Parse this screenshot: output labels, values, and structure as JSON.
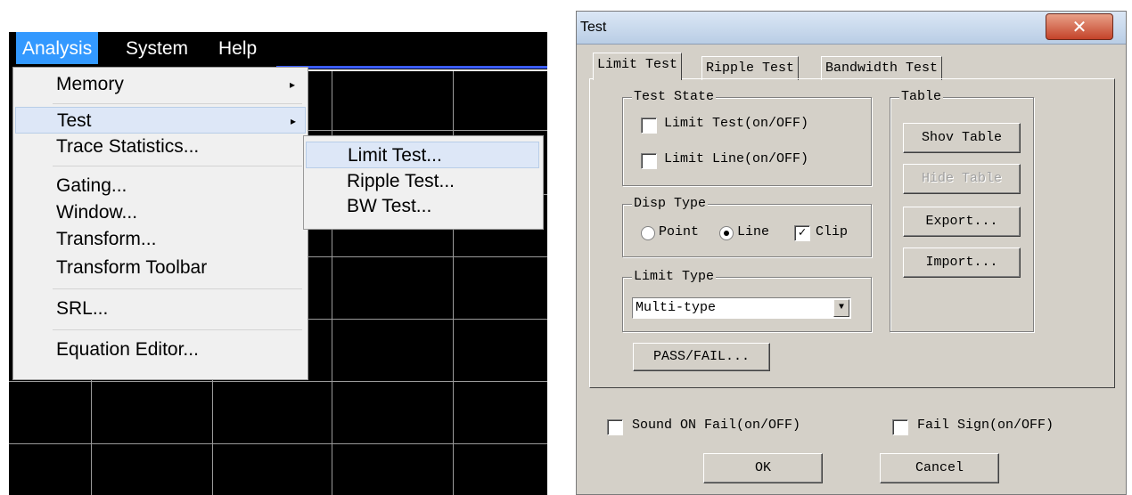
{
  "analyzer": {
    "menubar": [
      "Analysis",
      "System",
      "Help"
    ],
    "analysis_menu": {
      "items": [
        {
          "label": "Memory",
          "arrow": "▸"
        },
        {
          "label": "Test",
          "arrow": "▸"
        },
        {
          "label": "Trace Statistics..."
        },
        {
          "label": "Gating..."
        },
        {
          "label": "Window..."
        },
        {
          "label": "Transform..."
        },
        {
          "label": "Transform Toolbar"
        },
        {
          "label": "SRL..."
        },
        {
          "label": "Equation Editor..."
        }
      ],
      "highlighted": "Test"
    },
    "test_submenu": {
      "items": [
        "Limit Test...",
        "Ripple Test...",
        "BW Test..."
      ],
      "highlighted": "Limit Test..."
    }
  },
  "dialog": {
    "title": "Test",
    "close_glyph": "✕",
    "tabs": [
      "Limit Test",
      "Ripple Test",
      "Bandwidth Test"
    ],
    "active_tab": "Limit Test",
    "test_state": {
      "title": "Test State",
      "limit_test": {
        "label": "Limit Test(on/OFF)",
        "checked": false
      },
      "limit_line": {
        "label": "Limit Line(on/OFF)",
        "checked": false
      }
    },
    "disp_type": {
      "title": "Disp Type",
      "point_label": "Point",
      "line_label": "Line",
      "selected": "Line",
      "clip_label": "Clip",
      "clip_checked": true,
      "check_glyph": "✓"
    },
    "limit_type": {
      "title": "Limit Type",
      "value": "Multi-type",
      "dropdown_glyph": "▼"
    },
    "pass_fail_button": "PASS/FAIL...",
    "table": {
      "title": "Table",
      "show_table": "Shov Table",
      "hide_table": "Hide Table",
      "export": "Export...",
      "import": "Import..."
    },
    "sound_on_fail": {
      "label": "Sound ON Fail(on/OFF)",
      "checked": false
    },
    "fail_sign": {
      "label": "Fail Sign(on/OFF)",
      "checked": false
    },
    "ok": "OK",
    "cancel": "Cancel"
  }
}
